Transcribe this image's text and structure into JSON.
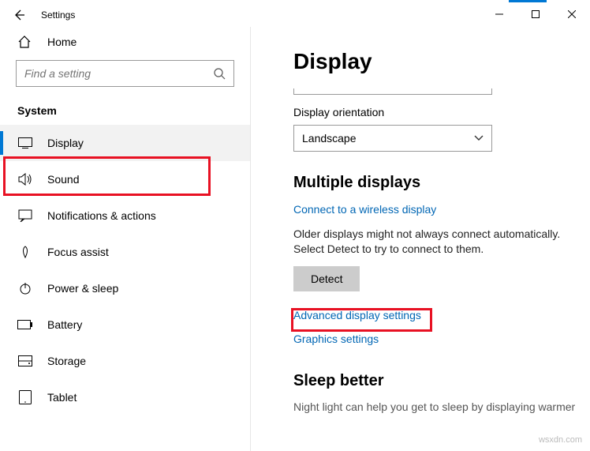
{
  "window": {
    "title": "Settings",
    "min": "—",
    "max": "☐",
    "close": "✕"
  },
  "sidebar": {
    "home": "Home",
    "search_placeholder": "Find a setting",
    "category": "System",
    "items": [
      {
        "label": "Display"
      },
      {
        "label": "Sound"
      },
      {
        "label": "Notifications & actions"
      },
      {
        "label": "Focus assist"
      },
      {
        "label": "Power & sleep"
      },
      {
        "label": "Battery"
      },
      {
        "label": "Storage"
      },
      {
        "label": "Tablet"
      }
    ]
  },
  "content": {
    "page_title": "Display",
    "orientation_label": "Display orientation",
    "orientation_value": "Landscape",
    "multiple_h": "Multiple displays",
    "wireless_link": "Connect to a wireless display",
    "older_text": "Older displays might not always connect automatically. Select Detect to try to connect to them.",
    "detect_btn": "Detect",
    "adv_link": "Advanced display settings",
    "graphics_link": "Graphics settings",
    "sleep_h": "Sleep better",
    "sleep_text": "Night light can help you get to sleep by displaying warmer"
  },
  "watermark": "wsxdn.com"
}
